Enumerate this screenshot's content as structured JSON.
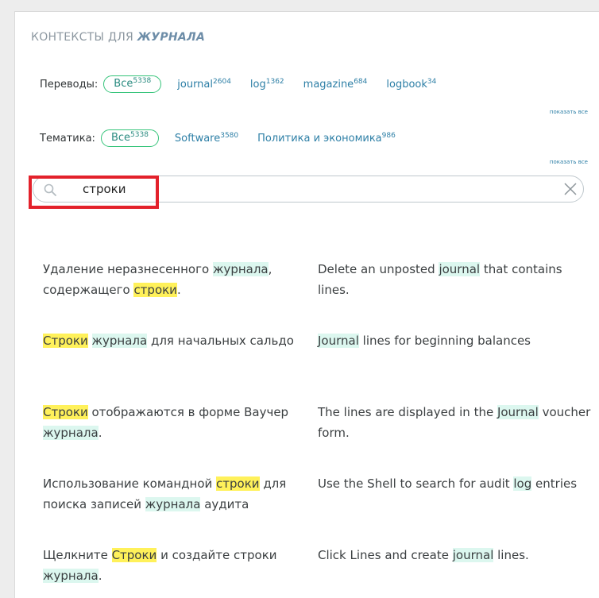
{
  "header": {
    "prefix": "КОНТЕКСТЫ ДЛЯ",
    "word": "ЖУРНАЛА"
  },
  "translations": {
    "label": "Переводы:",
    "all": {
      "label": "Все",
      "count": "5338"
    },
    "options": [
      {
        "label": "journal",
        "count": "2604"
      },
      {
        "label": "log",
        "count": "1362"
      },
      {
        "label": "magazine",
        "count": "684"
      },
      {
        "label": "logbook",
        "count": "34"
      }
    ],
    "show_all": "показать все"
  },
  "topics": {
    "label": "Тематика:",
    "all": {
      "label": "Все",
      "count": "5338"
    },
    "options": [
      {
        "label": "Software",
        "count": "3580"
      },
      {
        "label": "Политика и экономика",
        "count": "986"
      }
    ],
    "show_all": "показать все"
  },
  "search": {
    "value": "строки"
  },
  "results": [
    {
      "source": [
        {
          "t": "Удаление неразнесенного "
        },
        {
          "t": "журнала",
          "h": "g"
        },
        {
          "t": ", содержащего "
        },
        {
          "t": "строки",
          "h": "y"
        },
        {
          "t": "."
        }
      ],
      "target": [
        {
          "t": "Delete an unposted "
        },
        {
          "t": "journal",
          "h": "g"
        },
        {
          "t": " that contains lines."
        }
      ]
    },
    {
      "source": [
        {
          "t": "Строки",
          "h": "y"
        },
        {
          "t": " "
        },
        {
          "t": "журнала",
          "h": "g"
        },
        {
          "t": " для начальных сальдо"
        }
      ],
      "target": [
        {
          "t": "Journal",
          "h": "g"
        },
        {
          "t": " lines for beginning balances"
        }
      ]
    },
    {
      "source": [
        {
          "t": "Строки",
          "h": "y"
        },
        {
          "t": " отображаются в форме Ваучер "
        },
        {
          "t": "журнала",
          "h": "g"
        },
        {
          "t": "."
        }
      ],
      "target": [
        {
          "t": "The lines are displayed in the "
        },
        {
          "t": "Journal",
          "h": "g"
        },
        {
          "t": " voucher form."
        }
      ]
    },
    {
      "source": [
        {
          "t": "Использование командной "
        },
        {
          "t": "строки",
          "h": "y"
        },
        {
          "t": " для поиска записей "
        },
        {
          "t": "журнала",
          "h": "g"
        },
        {
          "t": " аудита"
        }
      ],
      "target": [
        {
          "t": "Use the Shell to search for audit "
        },
        {
          "t": "log",
          "h": "g"
        },
        {
          "t": " entries"
        }
      ]
    },
    {
      "source": [
        {
          "t": "Щелкните "
        },
        {
          "t": "Строки",
          "h": "y"
        },
        {
          "t": " и создайте строки "
        },
        {
          "t": "журнала",
          "h": "g"
        },
        {
          "t": "."
        }
      ],
      "target": [
        {
          "t": "Click Lines and create "
        },
        {
          "t": "journal",
          "h": "g"
        },
        {
          "t": " lines."
        }
      ]
    }
  ],
  "colors": {
    "pill_border": "#35c47a",
    "link": "#2d7fa6",
    "highlight_query": "#fff15a",
    "highlight_term": "#dcf7ef",
    "annotation_box": "#e3212b"
  },
  "icons": {
    "search": "search-icon",
    "clear": "close-icon"
  }
}
